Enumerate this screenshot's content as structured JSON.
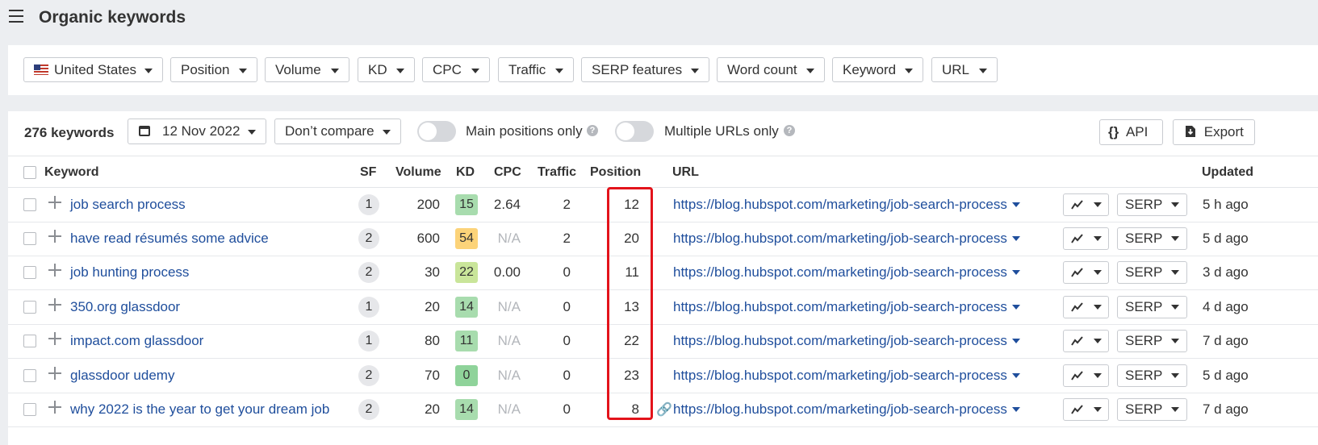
{
  "header": {
    "title": "Organic keywords"
  },
  "filters": [
    {
      "label": "United States",
      "flag": true
    },
    {
      "label": "Position"
    },
    {
      "label": "Volume"
    },
    {
      "label": "KD"
    },
    {
      "label": "CPC"
    },
    {
      "label": "Traffic"
    },
    {
      "label": "SERP features"
    },
    {
      "label": "Word count"
    },
    {
      "label": "Keyword"
    },
    {
      "label": "URL"
    }
  ],
  "toolbar": {
    "count": "276 keywords",
    "date": "12 Nov 2022",
    "compare": "Don’t compare",
    "main_positions": "Main positions only",
    "multiple_urls": "Multiple URLs only",
    "help": "?",
    "api": "API",
    "api_icon": "{}",
    "export": "Export"
  },
  "table": {
    "headers": {
      "keyword": "Keyword",
      "sf": "SF",
      "volume": "Volume",
      "kd": "KD",
      "cpc": "CPC",
      "traffic": "Traffic",
      "position": "Position",
      "url": "URL",
      "updated": "Updated"
    },
    "rows": [
      {
        "keyword": "job search process",
        "sf": "1",
        "volume": "200",
        "kd": "15",
        "kd_color": "#a8dcae",
        "cpc": "2.64",
        "traffic": "2",
        "position": "12",
        "url": "https://blog.hubspot.com/marketing/job-search-process",
        "serp": "SERP",
        "updated": "5 h ago"
      },
      {
        "keyword": "have read résumés some advice",
        "sf": "2",
        "volume": "600",
        "kd": "54",
        "kd_color": "#fcd379",
        "cpc": "N/A",
        "traffic": "2",
        "position": "20",
        "url": "https://blog.hubspot.com/marketing/job-search-process",
        "serp": "SERP",
        "updated": "5 d ago"
      },
      {
        "keyword": "job hunting process",
        "sf": "2",
        "volume": "30",
        "kd": "22",
        "kd_color": "#c9e59a",
        "cpc": "0.00",
        "traffic": "0",
        "position": "11",
        "url": "https://blog.hubspot.com/marketing/job-search-process",
        "serp": "SERP",
        "updated": "3 d ago"
      },
      {
        "keyword": "350.org glassdoor",
        "sf": "1",
        "volume": "20",
        "kd": "14",
        "kd_color": "#a8dcae",
        "cpc": "N/A",
        "traffic": "0",
        "position": "13",
        "url": "https://blog.hubspot.com/marketing/job-search-process",
        "serp": "SERP",
        "updated": "4 d ago"
      },
      {
        "keyword": "impact.com glassdoor",
        "sf": "1",
        "volume": "80",
        "kd": "11",
        "kd_color": "#a8dcae",
        "cpc": "N/A",
        "traffic": "0",
        "position": "22",
        "url": "https://blog.hubspot.com/marketing/job-search-process",
        "serp": "SERP",
        "updated": "7 d ago"
      },
      {
        "keyword": "glassdoor udemy",
        "sf": "2",
        "volume": "70",
        "kd": "0",
        "kd_color": "#8fd39a",
        "cpc": "N/A",
        "traffic": "0",
        "position": "23",
        "url": "https://blog.hubspot.com/marketing/job-search-process",
        "serp": "SERP",
        "updated": "5 d ago"
      },
      {
        "keyword": "why 2022 is the year to get your dream job",
        "sf": "2",
        "volume": "20",
        "kd": "14",
        "kd_color": "#a8dcae",
        "cpc": "N/A",
        "traffic": "0",
        "position": "8",
        "url": "https://blog.hubspot.com/marketing/job-search-process",
        "serp": "SERP",
        "updated": "7 d ago",
        "link_icon": true
      }
    ]
  },
  "colors": {
    "link": "#1f4e9c",
    "highlight": "#e3131b",
    "na": "#b3b6bb"
  }
}
